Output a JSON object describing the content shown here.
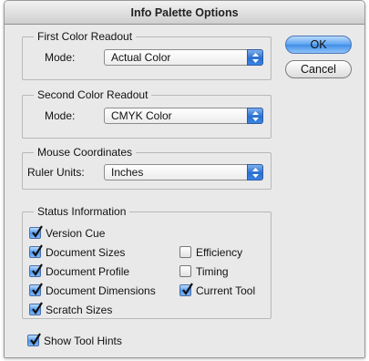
{
  "window": {
    "title": "Info Palette Options"
  },
  "buttons": {
    "ok": "OK",
    "cancel": "Cancel"
  },
  "first_color": {
    "title": "First Color Readout",
    "mode_label": "Mode:",
    "mode_value": "Actual Color"
  },
  "second_color": {
    "title": "Second Color Readout",
    "mode_label": "Mode:",
    "mode_value": "CMYK Color"
  },
  "mouse": {
    "title": "Mouse Coordinates",
    "units_label": "Ruler Units:",
    "units_value": "Inches"
  },
  "status": {
    "title": "Status Information",
    "items": [
      {
        "label": "Version Cue",
        "checked": true
      },
      {
        "label": "Document Sizes",
        "checked": true
      },
      {
        "label": "Document Profile",
        "checked": true
      },
      {
        "label": "Document Dimensions",
        "checked": true
      },
      {
        "label": "Scratch Sizes",
        "checked": true
      },
      {
        "label": "Efficiency",
        "checked": false
      },
      {
        "label": "Timing",
        "checked": false
      },
      {
        "label": "Current Tool",
        "checked": true
      }
    ]
  },
  "show_tool_hints": {
    "label": "Show Tool Hints",
    "checked": true
  },
  "colors": {
    "accent": "#3f8de8",
    "window_bg": "#e9e9e9"
  }
}
